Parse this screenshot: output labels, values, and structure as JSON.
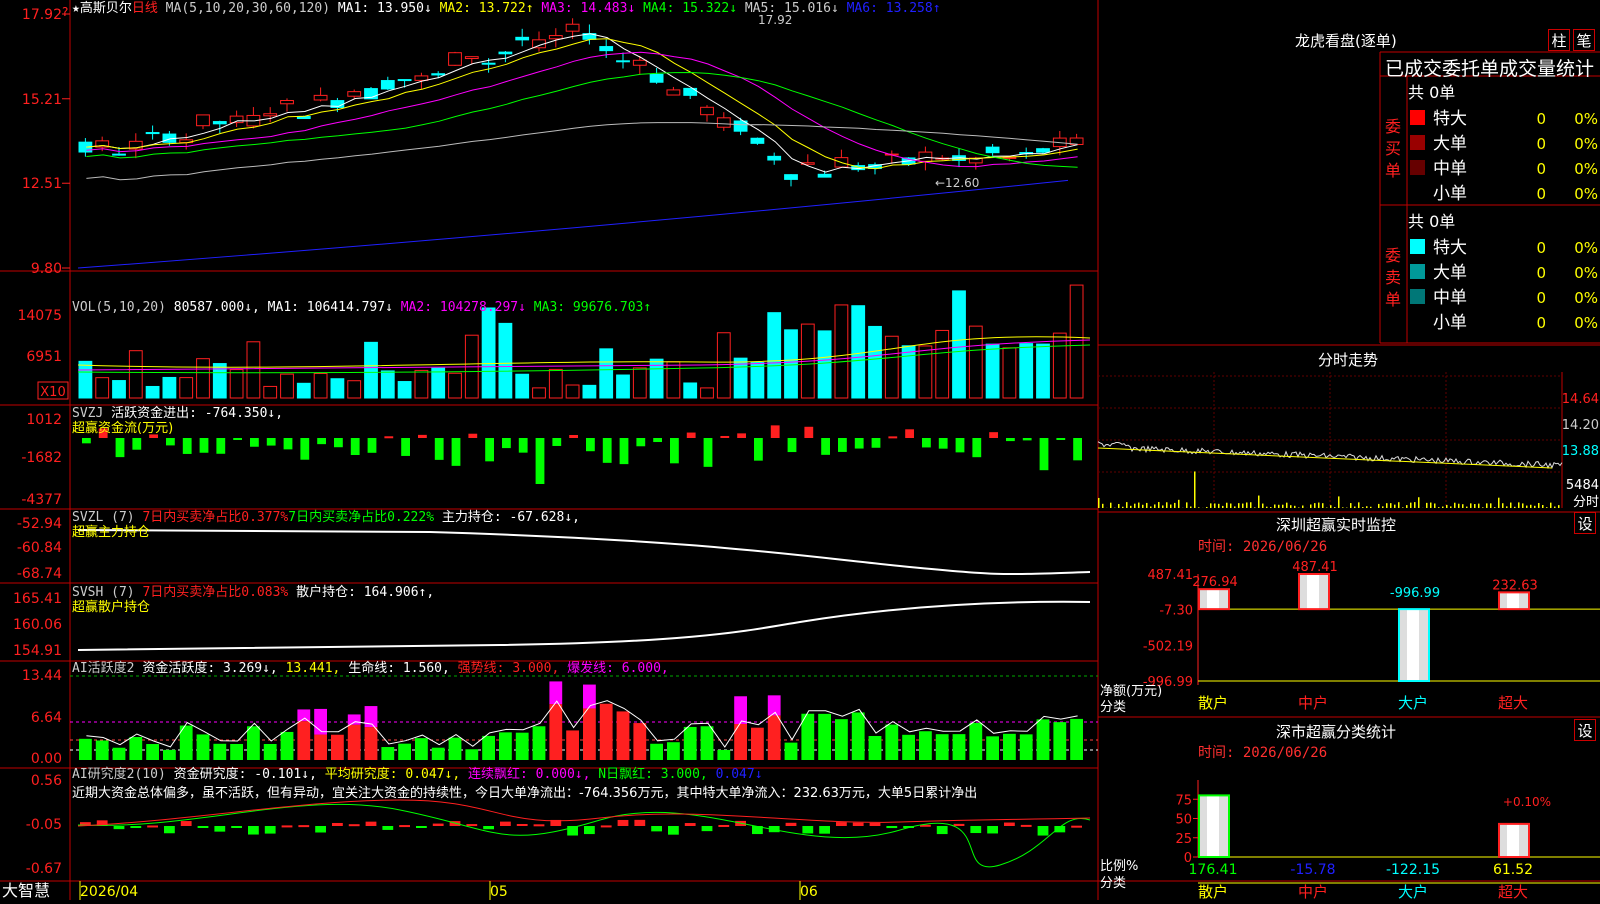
{
  "logo": "大智慧",
  "main_chart": {
    "title": "★高斯贝尔",
    "period": "日线",
    "ma_param": "MA(5,10,20,30,60,120)",
    "ma": [
      {
        "label": "MA1: 13.950↓",
        "color": "#ffffff"
      },
      {
        "label": "MA2: 13.722↑",
        "color": "#ffff00"
      },
      {
        "label": "MA3: 14.483↓",
        "color": "#ff00ff"
      },
      {
        "label": "MA4: 15.322↓",
        "color": "#00ff00"
      },
      {
        "label": "MA5: 15.016↓",
        "color": "#cccccc"
      },
      {
        "label": "MA6: 13.258↑",
        "color": "#2020ff"
      }
    ],
    "y_ticks": [
      "17.92",
      "15.21",
      "12.51",
      "9.80"
    ],
    "high_label": "17.92",
    "low_label": "←12.60"
  },
  "vol_panel": {
    "title": "VOL(5,10,20)",
    "value": "80587.000↓",
    "ma": [
      {
        "label": "MA1: 106414.797↓",
        "color": "#ffffff"
      },
      {
        "label": "MA2: 104278.297↓",
        "color": "#ff00ff"
      },
      {
        "label": "MA3: 99676.703↑",
        "color": "#00ff00"
      }
    ],
    "y_ticks": [
      "14075",
      "6951"
    ],
    "unit": "X10"
  },
  "svzj_panel": {
    "title": "SVZJ",
    "label": "活跃资金进出: -764.350↓,",
    "sub": "超赢资金流(万元)",
    "y_ticks": [
      "1012",
      "-1682",
      "-4377"
    ]
  },
  "svzl_panel": {
    "title": "SVZL (7)",
    "label1": "7日内买卖净占比0.377%",
    "label2": "7日内买卖净占比0.222%",
    "label3": "主力持仓: -67.628↓,",
    "sub": "超赢主力持仓",
    "y_ticks": [
      "-52.94",
      "-60.84",
      "-68.74"
    ]
  },
  "svsh_panel": {
    "title": "SVSH (7)",
    "label1": "7日内买卖净占比0.083%",
    "label2": "散户持仓: 164.906↑,",
    "sub": "超赢散户持仓",
    "y_ticks": [
      "165.41",
      "160.06",
      "154.91"
    ]
  },
  "ai_panel": {
    "title": "AI活跃度2",
    "label1": "资金活跃度: 3.269↓,",
    "label2": "13.441,",
    "label3": "生命线: 1.560,",
    "label4": "强势线: 3.000,",
    "label5": "爆发线: 6.000,",
    "y_ticks": [
      "13.44",
      "6.64",
      "0.00"
    ]
  },
  "research_panel": {
    "title": "AI研究度2(10)",
    "label1": "资金研究度: -0.101↓,",
    "label2": "平均研究度: 0.047↓,",
    "label3": "连续飘红: 0.000↓,",
    "label4": "N日飘红: 3.000,",
    "label5": "0.047↓",
    "sentence": "近期大资金总体偏多，虽不活跃，但有异动，宜关注大资金的持续性，今日大单净流出：-764.356万元，其中特大单净流入：232.63万元，大单5日累计净出",
    "y_ticks": [
      "0.56",
      "-0.05",
      "-0.67"
    ]
  },
  "x_axis": {
    "labels": [
      "2026/04",
      "05",
      "06"
    ]
  },
  "right_panel": {
    "dragon": {
      "title": "龙虎看盘(逐单)",
      "btn1": "柱",
      "btn2": "笔",
      "subtitle": "已成交委托单成交量统计",
      "buy": {
        "side_label": "委买单",
        "count": "共 0单",
        "rows": [
          {
            "label": "特大",
            "value": "0",
            "pct": "0%",
            "color": "#ff0000"
          },
          {
            "label": "大单",
            "value": "0",
            "pct": "0%",
            "color": "#990000"
          },
          {
            "label": "中单",
            "value": "0",
            "pct": "0%",
            "color": "#660000"
          },
          {
            "label": "小单",
            "value": "0",
            "pct": "0%",
            "color": ""
          }
        ]
      },
      "sell": {
        "side_label": "委卖单",
        "count": "共 0单",
        "rows": [
          {
            "label": "特大",
            "value": "0",
            "pct": "0%",
            "color": "#00ffff"
          },
          {
            "label": "大单",
            "value": "0",
            "pct": "0%",
            "color": "#009999"
          },
          {
            "label": "中单",
            "value": "0",
            "pct": "0%",
            "color": "#007777"
          },
          {
            "label": "小单",
            "value": "0",
            "pct": "0%",
            "color": ""
          }
        ]
      }
    },
    "intraday": {
      "title": "分时走势",
      "y_ticks": [
        "14.64",
        "14.20",
        "13.88"
      ],
      "vol_label": "5484",
      "vol_unit": "分时"
    },
    "monitor": {
      "title": "深圳超赢实时监控",
      "btn": "设",
      "time": "时间: 2026/06/26",
      "y_ticks": [
        "487.41",
        "-7.30",
        "-502.19",
        "-996.99"
      ],
      "ylabel": "净额(万元)",
      "xlabel": "分类",
      "categories": [
        "散户",
        "中户",
        "大户",
        "超大"
      ],
      "values": [
        276.94,
        487.41,
        -996.99,
        232.63
      ],
      "value_labels": [
        "276.94",
        "487.41",
        "-996.99",
        "232.63"
      ]
    },
    "classify": {
      "title": "深市超赢分类统计",
      "btn": "设",
      "time": "时间: 2026/06/26",
      "y_ticks": [
        "75",
        "50",
        "25",
        "0"
      ],
      "ylabel": "比例%",
      "xlabel": "分类",
      "categories": [
        "散户",
        "中户",
        "大户",
        "超大"
      ],
      "bar_pct": [
        80,
        0,
        0,
        43
      ],
      "top_label": "+0.10%",
      "bottom_values": [
        "176.41",
        "-15.78",
        "-122.15",
        "61.52"
      ]
    }
  }
}
